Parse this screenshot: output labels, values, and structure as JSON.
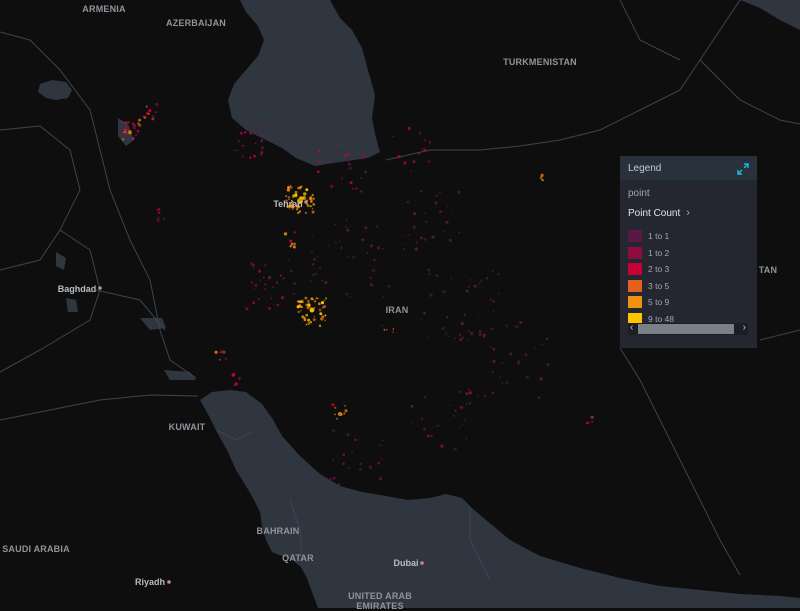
{
  "map": {
    "country_labels": [
      {
        "id": "armenia",
        "text": "ARMENIA"
      },
      {
        "id": "azerbaijan",
        "text": "AZERBAIJAN"
      },
      {
        "id": "turkmenistan",
        "text": "TURKMENISTAN"
      },
      {
        "id": "iran",
        "text": "IRAN"
      },
      {
        "id": "kuwait",
        "text": "KUWAIT"
      },
      {
        "id": "bahrain",
        "text": "BAHRAIN"
      },
      {
        "id": "qatar",
        "text": "QATAR"
      },
      {
        "id": "saudi-arabia",
        "text": "SAUDI ARABIA"
      },
      {
        "id": "uae-1",
        "text": "UNITED ARAB"
      },
      {
        "id": "uae-2",
        "text": "EMIRATES"
      },
      {
        "id": "afghanistan-partial",
        "text": "TAN"
      }
    ],
    "city_labels": [
      {
        "id": "tehran",
        "text": "Tehran"
      },
      {
        "id": "baghdad",
        "text": "Baghdad"
      },
      {
        "id": "dubai",
        "text": "Dubai"
      },
      {
        "id": "riyadh",
        "text": "Riyadh"
      }
    ],
    "colors": {
      "background": "#0e0e0f",
      "water": "#2f3640",
      "border": "#3d4550",
      "city_dot": "#c98a8a"
    }
  },
  "legend": {
    "title": "Legend",
    "collapse_icon": "collapse-arrows-icon",
    "layer_name": "point",
    "field_name": "Point Count",
    "field_icon": "chevron-right-icon",
    "bins": [
      {
        "label": "1 to 1",
        "color": "#5a1846"
      },
      {
        "label": "1 to 2",
        "color": "#900c3f"
      },
      {
        "label": "2 to 3",
        "color": "#c70039"
      },
      {
        "label": "3 to 5",
        "color": "#e3611c"
      },
      {
        "label": "5 to 9",
        "color": "#f1920e"
      },
      {
        "label": "9 to 48",
        "color": "#ffc300"
      }
    ],
    "scroll_left_icon": "chevron-left-icon",
    "scroll_right_icon": "chevron-right-icon"
  }
}
